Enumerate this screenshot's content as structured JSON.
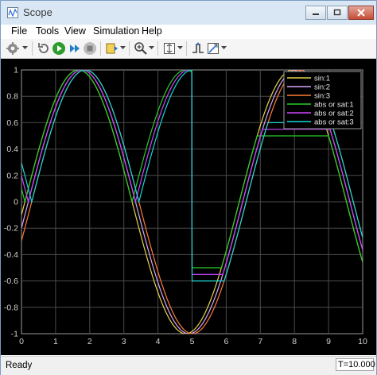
{
  "window": {
    "title": "Scope"
  },
  "menu": [
    "File",
    "Tools",
    "View",
    "Simulation",
    "Help"
  ],
  "toolbar_icons": [
    "settings-icon",
    "restore-layout-icon",
    "run-icon",
    "step-forward-icon",
    "stop-icon",
    "highlight-signal-icon",
    "zoom-icon",
    "autoscale-icon",
    "triggers-icon",
    "cursor-measurements-icon"
  ],
  "status": {
    "text": "Ready",
    "time": "T=10.000"
  },
  "colors": {
    "sin1": "#e5d44a",
    "sin2": "#d7a4ff",
    "sin3": "#ff7d36",
    "abs1": "#29cc29",
    "abs2": "#cc44ff",
    "abs3": "#18d6d6"
  },
  "chart_data": {
    "type": "line",
    "xlim": [
      0,
      10
    ],
    "ylim": [
      -1,
      1
    ],
    "xticks": [
      "0",
      "1",
      "2",
      "3",
      "4",
      "5",
      "6",
      "7",
      "8",
      "9",
      "10"
    ],
    "yticks": [
      "1",
      "0.8",
      "0.6",
      "0.4",
      "0.2",
      "0",
      "-0.2",
      "-0.4",
      "-0.6",
      "-0.8",
      "-1"
    ],
    "grid": true,
    "legend_position": "top-right",
    "series": [
      {
        "name": "sin:1",
        "phase": 0.1,
        "kind": "sin"
      },
      {
        "name": "sin:2",
        "phase": 0.2,
        "kind": "sin"
      },
      {
        "name": "sin:3",
        "phase": 0.3,
        "kind": "sin"
      },
      {
        "name": "abs or sat:1",
        "phase": 0.1,
        "kind": "abs_sat",
        "sat": 0.5
      },
      {
        "name": "abs or sat:2",
        "phase": 0.2,
        "kind": "abs_sat",
        "sat": 0.55
      },
      {
        "name": "abs or sat:3",
        "phase": 0.3,
        "kind": "abs_sat",
        "sat": 0.6
      }
    ],
    "switch_time": 5
  }
}
